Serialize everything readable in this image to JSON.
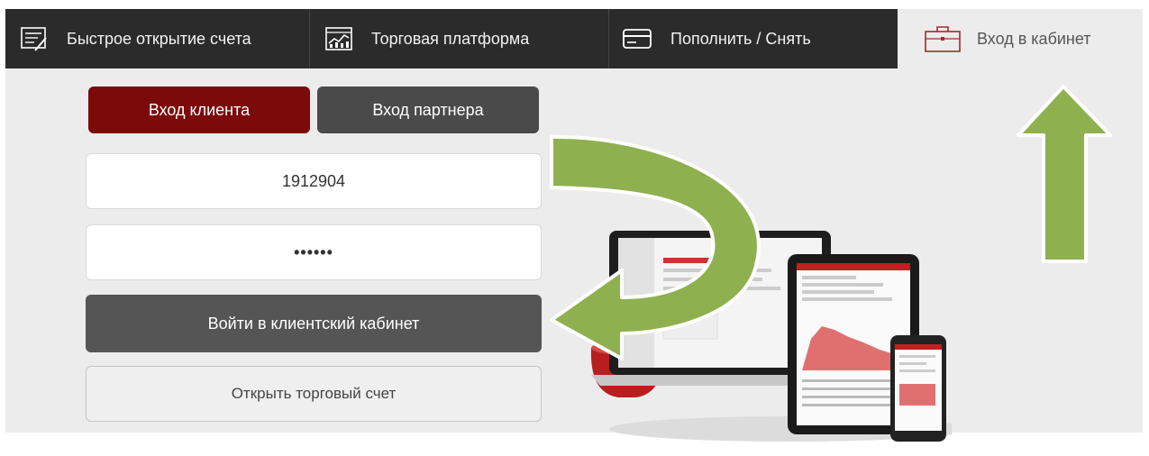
{
  "nav": {
    "tabs": [
      {
        "label": "Быстрое открытие счета",
        "icon": "document-pen-icon"
      },
      {
        "label": "Торговая платформа",
        "icon": "chart-monitor-icon"
      },
      {
        "label": "Пополнить / Снять",
        "icon": "credit-card-icon"
      }
    ],
    "active_tab": {
      "label": "Вход в кабинет",
      "icon": "briefcase-icon"
    }
  },
  "login": {
    "client_tab": "Вход клиента",
    "partner_tab": "Вход партнера",
    "login_value": "1912904",
    "password_value": "••••••",
    "submit": "Войти в клиентский кабинет",
    "open_account": "Открыть торговый счет"
  },
  "colors": {
    "nav_bg": "#2b2b2b",
    "active_tab_bg": "#ececec",
    "accent_red": "#7d0a0a",
    "button_dark": "#555555",
    "arrow_green": "#8fb04e"
  }
}
